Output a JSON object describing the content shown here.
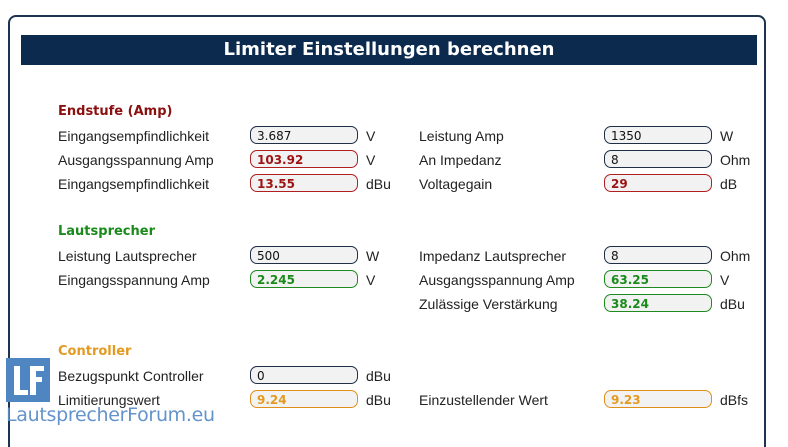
{
  "title": "Limiter Einstellungen berechnen",
  "colors": {
    "header_bg": "#0b2a4e",
    "amp": "#8b1010",
    "speaker": "#1a8a1a",
    "controller": "#e39a20"
  },
  "amp": {
    "title": "Endstufe (Amp)",
    "sens_label": "Eingangsempfindlichkeit",
    "sens_value": "3.687",
    "sens_unit": "V",
    "outvolt_label": "Ausgangsspannung Amp",
    "outvolt_value": "103.92",
    "outvolt_unit": "V",
    "sensdbu_label": "Eingangsempfindlichkeit",
    "sensdbu_value": "13.55",
    "sensdbu_unit": "dBu",
    "power_label": "Leistung Amp",
    "power_value": "1350",
    "power_unit": "W",
    "imp_label": "An Impedanz",
    "imp_value": "8",
    "imp_unit": "Ohm",
    "gain_label": "Voltagegain",
    "gain_value": "29",
    "gain_unit": "dB"
  },
  "speaker": {
    "title": "Lautsprecher",
    "power_label": "Leistung Lautsprecher",
    "power_value": "500",
    "power_unit": "W",
    "involt_label": "Eingangsspannung Amp",
    "involt_value": "2.245",
    "involt_unit": "V",
    "imp_label": "Impedanz Lautsprecher",
    "imp_value": "8",
    "imp_unit": "Ohm",
    "outvolt_label": "Ausgangsspannung Amp",
    "outvolt_value": "63.25",
    "outvolt_unit": "V",
    "gain_label": "Zulässige Verstärkung",
    "gain_value": "38.24",
    "gain_unit": "dBu"
  },
  "controller": {
    "title": "Controller",
    "ref_label": "Bezugspunkt Controller",
    "ref_value": "0",
    "ref_unit": "dBu",
    "limit_label": "Limitierungswert",
    "limit_value": "9.24",
    "limit_unit": "dBu",
    "set_label": "Einzustellender Wert",
    "set_value": "9.23",
    "set_unit": "dBfs"
  },
  "watermark": {
    "logo_letters": "LF",
    "text": "LautsprecherForum.eu"
  }
}
